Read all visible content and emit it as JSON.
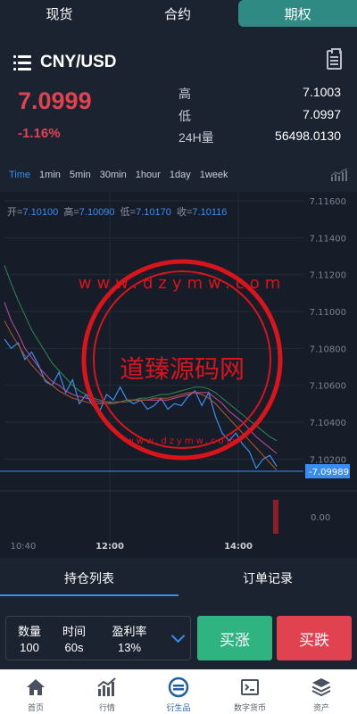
{
  "top_tabs": [
    {
      "label": "现货",
      "active": false
    },
    {
      "label": "合约",
      "active": false
    },
    {
      "label": "期权",
      "active": true
    }
  ],
  "pair": {
    "name": "CNY/USD",
    "icon_left": "menu-icon",
    "icon_right": "document-icon"
  },
  "price": {
    "last": "7.0999",
    "change": "-1.16%",
    "color": "#e0434f"
  },
  "stats": [
    {
      "key": "高",
      "value": "7.1003"
    },
    {
      "key": "低",
      "value": "7.0997"
    },
    {
      "key": "24H量",
      "value": "56498.0130"
    }
  ],
  "intervals": [
    "Time",
    "1min",
    "5min",
    "30min",
    "1hour",
    "1day",
    "1week"
  ],
  "active_interval": "Time",
  "ohlc": {
    "open_label": "开=",
    "open": "7.10100",
    "high_label": "高=",
    "high": "7.10090",
    "low_label": "低=",
    "low": "7.10170",
    "close_label": "收=",
    "close": "7.10116"
  },
  "chart_data": {
    "type": "line",
    "y_axis_ticks": [
      "7.11600",
      "7.11400",
      "7.11200",
      "7.11000",
      "7.10800",
      "7.10600",
      "7.10400",
      "7.10200"
    ],
    "ylim": [
      7.101,
      7.116
    ],
    "x_axis_ticks": [
      "10:40",
      "12:00",
      "14:00"
    ],
    "current_price_label": "7.09989",
    "volume_axis_tick": "0.00",
    "series": [
      {
        "values": [
          7.1085,
          7.108,
          7.1083,
          7.1074,
          7.1078,
          7.1071,
          7.1062,
          7.106,
          7.1067,
          7.1056,
          7.1063,
          7.105,
          7.1055,
          7.1049,
          7.1046,
          7.1055,
          7.1052,
          7.1059,
          7.1052,
          7.105,
          7.1052,
          7.1047,
          7.1049,
          7.1053,
          7.1047,
          7.105,
          7.1049,
          7.1054,
          7.1057,
          7.1049,
          7.1056,
          7.1043,
          7.1034,
          7.103,
          7.1034,
          7.1028,
          7.1024,
          7.1015,
          7.102,
          7.1022,
          7.1016
        ],
        "color": "#3a8df0"
      },
      {
        "values": [
          7.1105,
          7.1095,
          7.1088,
          7.108,
          7.1075,
          7.107,
          7.1066,
          7.1062,
          7.106,
          7.1057,
          7.1055,
          7.1054,
          7.1053,
          7.1052,
          7.1051,
          7.1051,
          7.105,
          7.1051,
          7.1052,
          7.1052,
          7.1052,
          7.1052,
          7.1052,
          7.1052,
          7.1052,
          7.1053,
          7.1054,
          7.1055,
          7.1056,
          7.1056,
          7.1056,
          7.1053,
          7.105,
          7.1046,
          7.1043,
          7.104,
          7.1036,
          7.1032,
          7.1029,
          7.1026,
          7.1023
        ],
        "color": "#c04d9a"
      },
      {
        "values": [
          7.1125,
          7.1115,
          7.1106,
          7.1098,
          7.109,
          7.1084,
          7.1078,
          7.1072,
          7.1068,
          7.1064,
          7.106,
          7.1057,
          7.1055,
          7.1053,
          7.1052,
          7.1051,
          7.1051,
          7.1051,
          7.1052,
          7.1052,
          7.1053,
          7.1053,
          7.1054,
          7.1055,
          7.1055,
          7.1056,
          7.1057,
          7.1058,
          7.1059,
          7.1059,
          7.1058,
          7.1056,
          7.1053,
          7.105,
          7.1047,
          7.1044,
          7.1041,
          7.1038,
          7.1035,
          7.1032,
          7.103
        ],
        "color": "#2f8a55"
      },
      {
        "values": [
          7.1095,
          7.1088,
          7.1082,
          7.1076,
          7.1071,
          7.1067,
          7.1063,
          7.106,
          7.1057,
          7.1055,
          7.1053,
          7.1052,
          7.1051,
          7.105,
          7.105,
          7.105,
          7.105,
          7.1051,
          7.1051,
          7.1052,
          7.1052,
          7.1052,
          7.1053,
          7.1053,
          7.1053,
          7.1054,
          7.1055,
          7.1056,
          7.1056,
          7.1055,
          7.1053,
          7.105,
          7.1046,
          7.1042,
          7.1038,
          7.1034,
          7.103,
          7.1026,
          7.1022,
          7.1018,
          7.1014
        ],
        "color": "#b05a2a"
      }
    ]
  },
  "watermark": {
    "text": "道臻源码网",
    "url_text": "www.dzymw.com"
  },
  "bottom_tabs": [
    {
      "label": "持仓列表",
      "active": true
    },
    {
      "label": "订单记录",
      "active": false
    }
  ],
  "order": {
    "qty_label": "数量",
    "qty_value": "100",
    "time_label": "时间",
    "time_value": "60s",
    "profit_label": "盈利率",
    "profit_value": "13%"
  },
  "buttons": {
    "up": "买涨",
    "down": "买跌",
    "up_color": "#2fb381",
    "down_color": "#e0434f"
  },
  "tabbar": [
    {
      "label": "首页",
      "icon": "home-icon",
      "active": false
    },
    {
      "label": "行情",
      "icon": "market-chart-icon",
      "active": false
    },
    {
      "label": "衍生品",
      "icon": "derivatives-icon",
      "active": true
    },
    {
      "label": "数字货币",
      "icon": "digital-currency-icon",
      "active": false
    },
    {
      "label": "资产",
      "icon": "assets-layers-icon",
      "active": false
    }
  ]
}
